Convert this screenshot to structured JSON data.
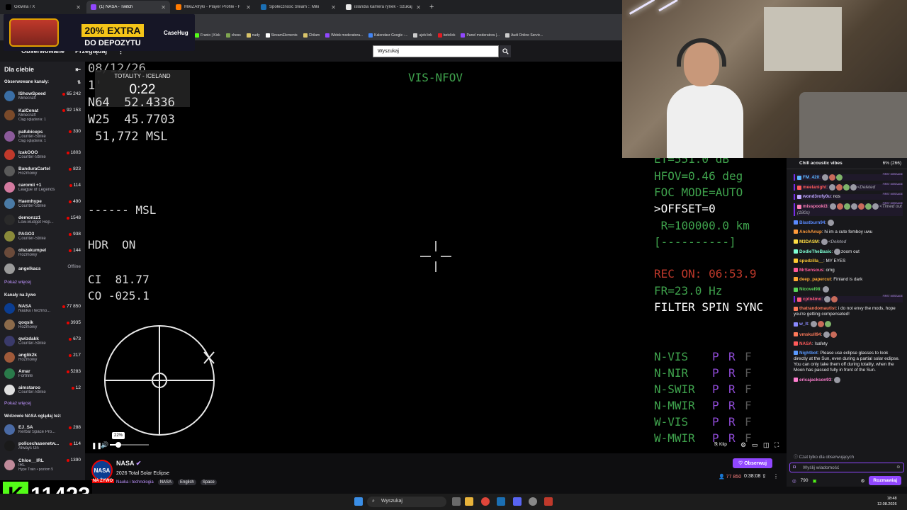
{
  "browser": {
    "tabs": [
      {
        "label": "Główna / X",
        "color": "#000000"
      },
      {
        "label": "(1) NASA - Twitch",
        "color": "#9147ff",
        "active": true
      },
      {
        "label": "MikiZAfryki - Player Profile - F",
        "color": "#ff7a00"
      },
      {
        "label": "Społeczność Steam :: Miki",
        "color": "#1b6fb3"
      },
      {
        "label": "islandia kamera rynek - Szukaj",
        "color": "#e8e8e8"
      }
    ],
    "bookmarks": [
      {
        "label": "Franio | Kick",
        "color": "#53fc18"
      },
      {
        "label": "chess",
        "color": "#7fa650"
      },
      {
        "label": "nudy",
        "color": "#d9c46a"
      },
      {
        "label": "StreamElements",
        "color": "#ffffff"
      },
      {
        "label": "Chilam",
        "color": "#d9c46a"
      },
      {
        "label": "Widok moderatora...",
        "color": "#9147ff"
      },
      {
        "label": "Kalendarz Google -...",
        "color": "#4285f4"
      },
      {
        "label": "ujeb link",
        "color": "#cccccc"
      },
      {
        "label": "betclick",
        "color": "#e31b23"
      },
      {
        "label": "Panel moderatora |...",
        "color": "#9147ff"
      },
      {
        "label": "Audi Online Servic...",
        "color": "#cccccc"
      }
    ]
  },
  "ad": {
    "offer_line1": "20% EXTRA",
    "offer_line2": "DO DEPOZYTU",
    "brand": "CaseHug"
  },
  "twitch_nav": {
    "following": "Obserwowane",
    "browse": "Przeglądaj",
    "search_placeholder": "Wyszukaj"
  },
  "sidebar": {
    "title": "Dla ciebie",
    "followed_label": "Obserwowane kanały:",
    "followed": [
      {
        "name": "IShowSpeed",
        "game": "Minecraft",
        "viewers": "65 242",
        "color": "#3a6ea5"
      },
      {
        "name": "KaiCenat",
        "game": "Minecraft",
        "sub": "Ciąg oglądania: 1",
        "viewers": "92 153",
        "color": "#7a4a2a"
      },
      {
        "name": "pafubiceps",
        "game": "Counter-Strike",
        "sub": "Ciąg oglądania: 1",
        "viewers": "330",
        "color": "#8b5a9a"
      },
      {
        "name": "IzakOOO",
        "game": "Counter-Strike",
        "viewers": "1803",
        "color": "#c0392b"
      },
      {
        "name": "BanduraCartel",
        "game": "Rozmowy",
        "viewers": "823",
        "color": "#5a5a5a"
      },
      {
        "name": "caromii +1",
        "game": "League of Legends",
        "viewers": "114",
        "color": "#d47aa0"
      },
      {
        "name": "Haemhype",
        "game": "Counter-Strike",
        "viewers": "490",
        "color": "#4a7aa5"
      },
      {
        "name": "demonzz1",
        "game": "Low-Budget Rep...",
        "viewers": "1548",
        "color": "#2a2a2a"
      },
      {
        "name": "PAGO3",
        "game": "Counter-Strike",
        "viewers": "938",
        "color": "#8a8a3a"
      },
      {
        "name": "olszakumpel",
        "game": "Rozmowy",
        "viewers": "144",
        "color": "#6a4a3a"
      },
      {
        "name": "angelkacs",
        "game": "",
        "viewers": "Offline",
        "color": "#9a9a9a",
        "offline": true
      }
    ],
    "show_more": "Pokaż więcej",
    "live_label": "Kanały na żywo",
    "live": [
      {
        "name": "NASA",
        "game": "Nauka i techno...",
        "viewers": "77 850",
        "color": "#0b3d91"
      },
      {
        "name": "qoqsik",
        "game": "Rozmowy",
        "viewers": "3935",
        "color": "#8b6a4a"
      },
      {
        "name": "qwizdakk",
        "game": "Counter-Strike",
        "viewers": "673",
        "color": "#3a3a6a"
      },
      {
        "name": "anglik2k",
        "game": "Rozmowy",
        "viewers": "217",
        "color": "#a05a3a"
      },
      {
        "name": "Amar",
        "game": "Fortnite",
        "viewers": "5283",
        "color": "#2a7a4a"
      },
      {
        "name": "aimstaroo",
        "game": "Counter-Strike",
        "viewers": "12",
        "color": "#e0e0e0"
      }
    ],
    "show_more2": "Pokaż więcej",
    "nasa_viewers_label": "Widzowie NASA oglądaj też:",
    "related": [
      {
        "name": "EJ_SA",
        "game": "Kerbal Space Pro...",
        "viewers": "288",
        "color": "#4a6aa5"
      },
      {
        "name": "policechasenetw...",
        "game": "Always On",
        "viewers": "114",
        "color": "#1a1a1a"
      },
      {
        "name": "Chloe__IRL",
        "game": "IRL",
        "sub": "Hype Train • poziom 5",
        "viewers": "1390",
        "color": "#c08a9a"
      }
    ]
  },
  "video_hud": {
    "date": "08/12/26",
    "line_partial": "1'",
    "lat": "N64  52.4336",
    "lon": "W25  45.7703",
    "msl": " 51,772 MSL",
    "msl2": "------ MSL",
    "hdr": "HDR  ON",
    "ci": "CI  81.77",
    "co": "CO -025.1",
    "mode": "VIS-NFOV",
    "et": "ET=551.0 dB",
    "hfov": "HFOV=0.46 deg",
    "foc": "FOC MODE=AUTO",
    "offset": ">OFFSET=0",
    "range": " R=100000.0 km",
    "bar": "[----------]",
    "rec": "REC ON: 06:53.9",
    "fr": "FR=23.0 Hz",
    "filter": "FILTER SPIN SYNC",
    "bands": [
      {
        "name": "N-VIS"
      },
      {
        "name": "N-NIR"
      },
      {
        "name": "N-SWIR"
      },
      {
        "name": "N-MWIR"
      },
      {
        "name": "W-VIS"
      },
      {
        "name": "W-MWIR"
      }
    ],
    "band_flags": [
      "P",
      "R",
      "F"
    ]
  },
  "overlay": {
    "title": "TOTALITY - ICELAND",
    "countdown": "0:22"
  },
  "player": {
    "volume_tooltip": "22%",
    "volume": 0.22,
    "clip_label": "Klip"
  },
  "chat": {
    "pinned_title": "Chill acoustic vibes",
    "pinned_pct": "6% (266)",
    "first_msg_label": "FIRST MESSAGE",
    "messages": [
      {
        "user": "FM_420",
        "color": "#5ab4ff",
        "text": "",
        "emotes": 3,
        "first": true
      },
      {
        "user": "meelanight",
        "color": "#ff5a5a",
        "text": "",
        "deleted": "<Deleted",
        "emotes": 4,
        "first": true
      },
      {
        "user": "wond3rofy0u",
        "color": "#bfa8ff",
        "text": "nos",
        "first": true
      },
      {
        "user": "misspooki3",
        "color": "#ff7fb5",
        "text": "",
        "deleted": "<Timed out (180s)",
        "emotes": 7,
        "first": true
      },
      {
        "user": "Blastburn94",
        "color": "#5a8aff",
        "text": "",
        "emotes": 1
      },
      {
        "user": "AnchAnup",
        "color": "#ff9a3a",
        "text": "hi im a cute femboy uwu"
      },
      {
        "user": "M3DASM",
        "color": "#ffdd44",
        "text": "",
        "deleted": "<Deleted",
        "emotes": 1
      },
      {
        "user": "DodieTheBasic",
        "color": "#7fffd4",
        "text": "zoom out",
        "emotes": 1
      },
      {
        "user": "spudzilla__",
        "color": "#ffcc33",
        "text": "MY EYES"
      },
      {
        "user": "MrSensous",
        "color": "#ff5a9a",
        "text": "omg"
      },
      {
        "user": "deep_papercut",
        "color": "#ffaa33",
        "text": "Finland is dark"
      },
      {
        "user": "Nicovel98",
        "color": "#5ad75a",
        "text": "",
        "emotes": 1
      },
      {
        "user": "cptn4mo",
        "color": "#ff5a7a",
        "text": "",
        "emotes": 2,
        "first": true
      },
      {
        "user": "thatrandomautist",
        "color": "#ff7a5a",
        "text": "i do not envy the mods, hope you're getting compenseted!"
      },
      {
        "user": "w_lt",
        "color": "#8a8aff",
        "text": "",
        "emotes": 3
      },
      {
        "user": "vmskull94",
        "color": "#ff7a5a",
        "text": "",
        "emotes": 2
      },
      {
        "user": "NASA",
        "color": "#ff5a5a",
        "text": "!safety"
      },
      {
        "user": "Nightbot",
        "color": "#5a9aff",
        "text": "Please use eclipse glasses to look directly at the Sun, even during a partial solar eclipse. You can only take them off during totality, when the Moon has passed fully in front of the Sun."
      },
      {
        "user": "ericajackson93",
        "color": "#ff7fd0",
        "text": "",
        "emotes": 1
      }
    ],
    "restriction": "Czat tylko dla obserwujących",
    "input_placeholder": "Wyślij wiadomość",
    "points": "790",
    "send_label": "Rozmawiaj"
  },
  "stream_info": {
    "avatar_text": "NASA",
    "live_badge": "NA ŻYWO",
    "streamer": "NASA",
    "title": "2026 Total Solar Eclipse",
    "category": "Nauka i technologia",
    "tags": [
      "NASA",
      "English",
      "Space"
    ],
    "follow_label": "Obserwuj",
    "viewers": "77 850",
    "uptime": "0:38:08"
  },
  "sub_counter": {
    "logo": "K",
    "count": "11423"
  },
  "taskbar": {
    "search_label": "Wyszukaj",
    "time": "18:48",
    "date": "12.08.2026"
  }
}
